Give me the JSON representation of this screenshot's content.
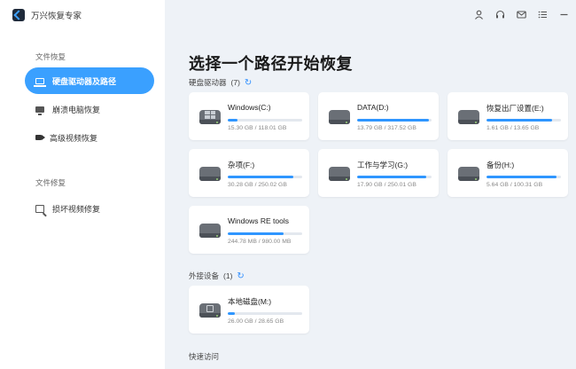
{
  "app": {
    "title": "万兴恢复专家"
  },
  "sidebar": {
    "sections": [
      {
        "label": "文件恢复",
        "items": [
          {
            "label": "硬盘驱动器及路径",
            "icon": "hard-drive-icon",
            "active": true
          },
          {
            "label": "崩溃电脑恢复",
            "icon": "monitor-icon",
            "active": false
          },
          {
            "label": "高级视频恢复",
            "icon": "video-camera-icon",
            "active": false
          }
        ]
      },
      {
        "label": "文件修复",
        "items": [
          {
            "label": "损坏视频修复",
            "icon": "video-repair-icon",
            "active": false
          }
        ]
      }
    ]
  },
  "topbar": {
    "icons": [
      "user-icon",
      "headset-icon",
      "mail-icon",
      "menu-icon",
      "minimize-icon"
    ]
  },
  "main": {
    "title": "选择一个路径开始恢复",
    "hard_drives": {
      "label": "硬盘驱动器",
      "count": "(7)",
      "drives": [
        {
          "name": "Windows(C:)",
          "size": "15.30 GB / 118.01 GB",
          "usage": 0.13,
          "icon": "windows-drive-icon"
        },
        {
          "name": "DATA(D:)",
          "size": "13.79 GB / 317.52 GB",
          "usage": 0.96,
          "icon": "drive-icon"
        },
        {
          "name": "恢复出厂设置(E:)",
          "size": "1.61 GB / 13.65 GB",
          "usage": 0.88,
          "icon": "drive-icon"
        },
        {
          "name": "杂项(F:)",
          "size": "30.28 GB / 250.02 GB",
          "usage": 0.88,
          "icon": "drive-icon"
        },
        {
          "name": "工作与学习(G:)",
          "size": "17.90 GB / 250.01 GB",
          "usage": 0.93,
          "icon": "drive-icon"
        },
        {
          "name": "备份(H:)",
          "size": "5.64 GB / 100.31 GB",
          "usage": 0.94,
          "icon": "drive-icon"
        },
        {
          "name": "Windows RE tools",
          "size": "244.78 MB / 980.00 MB",
          "usage": 0.75,
          "icon": "drive-icon"
        }
      ]
    },
    "external": {
      "label": "外接设备",
      "count": "(1)",
      "drives": [
        {
          "name": "本地磁盘(M:)",
          "size": "26.00 GB / 28.65 GB",
          "usage": 0.09,
          "icon": "usb-drive-icon"
        }
      ]
    },
    "quick_access": {
      "label": "快速访问"
    }
  },
  "colors": {
    "accent": "#3aa0ff",
    "bar": "#2f96ff",
    "background": "#eef2f7"
  }
}
